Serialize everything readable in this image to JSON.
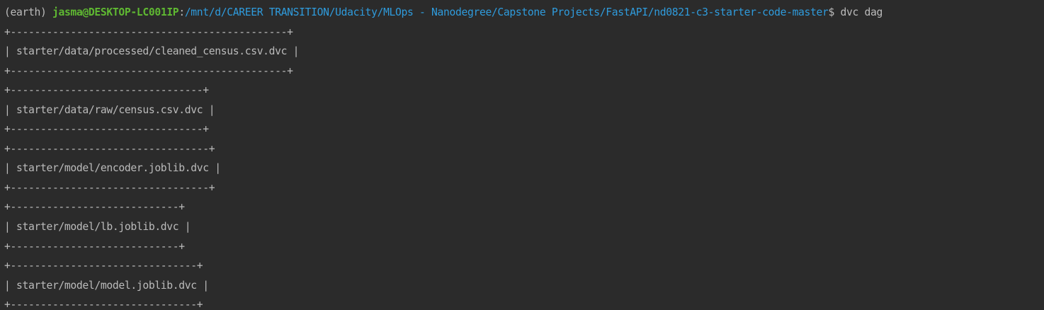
{
  "prompt": {
    "env": "(earth)",
    "userhost": "jasma@DESKTOP-LC001IP",
    "separator": ":",
    "path": "/mnt/d/CAREER TRANSITION/Udacity/MLOps - Nanodegree/Capstone Projects/FastAPI/nd0821-c3-starter-code-master",
    "symbol": "$",
    "command": "dvc dag"
  },
  "output_lines": [
    "+----------------------------------------------+",
    "| starter/data/processed/cleaned_census.csv.dvc |",
    "+----------------------------------------------+",
    "+--------------------------------+",
    "| starter/data/raw/census.csv.dvc |",
    "+--------------------------------+",
    "+---------------------------------+",
    "| starter/model/encoder.joblib.dvc |",
    "+---------------------------------+",
    "+----------------------------+",
    "| starter/model/lb.joblib.dvc |",
    "+----------------------------+",
    "+-------------------------------+",
    "| starter/model/model.joblib.dvc |",
    "+-------------------------------+"
  ],
  "colors": {
    "background": "#2b2b2b",
    "text": "#bbbbbb",
    "userhost": "#5fb832",
    "path": "#2f9bdc"
  }
}
